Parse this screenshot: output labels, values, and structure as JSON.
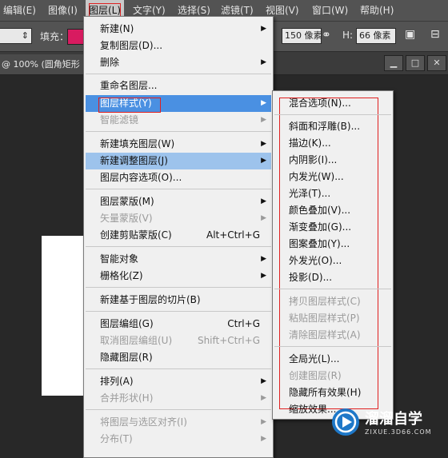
{
  "menubar": {
    "items": [
      "编辑(E)",
      "图像(I)",
      "图层(L)",
      "文字(Y)",
      "选择(S)",
      "滤镜(T)",
      "视图(V)",
      "窗口(W)",
      "帮助(H)"
    ],
    "active": "图层(L)"
  },
  "options": {
    "fill_label": "填充：",
    "fill_color": "#d81b60",
    "width_value": "150 像素",
    "h_label": "H:",
    "height_value": "66 像素"
  },
  "doc_tab": {
    "title": "@ 100% (圆角矩形 ..."
  },
  "layer_menu": {
    "items": [
      {
        "label": "新建(N)",
        "submenu": true
      },
      {
        "label": "复制图层(D)..."
      },
      {
        "label": "删除",
        "submenu": true
      },
      {
        "label": "重命名图层..."
      },
      {
        "label": "图层样式(Y)",
        "submenu": true,
        "state": "highlighted"
      },
      {
        "label": "智能滤镜",
        "submenu": true,
        "disabled": true
      },
      {
        "label": "新建填充图层(W)",
        "submenu": true
      },
      {
        "label": "新建调整图层(J)",
        "submenu": true,
        "state": "hover"
      },
      {
        "label": "图层内容选项(O)..."
      },
      {
        "label": "图层蒙版(M)",
        "submenu": true
      },
      {
        "label": "矢量蒙版(V)",
        "submenu": true,
        "disabled": true
      },
      {
        "label": "创建剪贴蒙版(C)",
        "shortcut": "Alt+Ctrl+G"
      },
      {
        "label": "智能对象",
        "submenu": true
      },
      {
        "label": "栅格化(Z)",
        "submenu": true
      },
      {
        "label": "新建基于图层的切片(B)"
      },
      {
        "label": "图层编组(G)",
        "shortcut": "Ctrl+G"
      },
      {
        "label": "取消图层编组(U)",
        "shortcut": "Shift+Ctrl+G",
        "disabled": true
      },
      {
        "label": "隐藏图层(R)"
      },
      {
        "label": "排列(A)",
        "submenu": true
      },
      {
        "label": "合并形状(H)",
        "submenu": true,
        "disabled": true
      },
      {
        "label": "将图层与选区对齐(I)",
        "submenu": true,
        "disabled": true
      },
      {
        "label": "分布(T)",
        "submenu": true,
        "disabled": true
      }
    ]
  },
  "style_submenu": {
    "items": [
      {
        "label": "混合选项(N)..."
      },
      {
        "label": "斜面和浮雕(B)..."
      },
      {
        "label": "描边(K)..."
      },
      {
        "label": "内阴影(I)..."
      },
      {
        "label": "内发光(W)..."
      },
      {
        "label": "光泽(T)..."
      },
      {
        "label": "颜色叠加(V)..."
      },
      {
        "label": "渐变叠加(G)..."
      },
      {
        "label": "图案叠加(Y)..."
      },
      {
        "label": "外发光(O)..."
      },
      {
        "label": "投影(D)..."
      },
      {
        "label": "拷贝图层样式(C)",
        "disabled": true
      },
      {
        "label": "粘贴图层样式(P)",
        "disabled": true
      },
      {
        "label": "清除图层样式(A)",
        "disabled": true
      },
      {
        "label": "全局光(L)..."
      },
      {
        "label": "创建图层(R)",
        "disabled": true
      },
      {
        "label": "隐藏所有效果(H)"
      },
      {
        "label": "缩放效果..."
      }
    ]
  },
  "watermark": {
    "title": "溜溜自学",
    "url": "ZIXUE.3D66.COM"
  }
}
